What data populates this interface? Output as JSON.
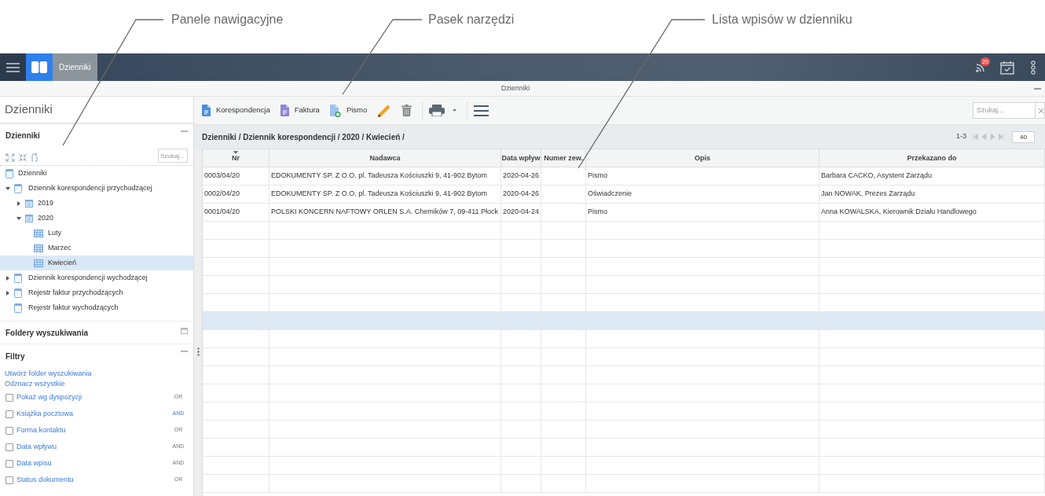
{
  "callouts": [
    {
      "label": "Panele nawigacyjne"
    },
    {
      "label": "Pasek narzędzi"
    },
    {
      "label": "Lista wpisów w dzienniku"
    }
  ],
  "app_bar": {
    "tabs": [
      {
        "label": "Dzienniki",
        "selected": true
      }
    ],
    "notifications": {
      "badge": "20"
    }
  },
  "window": {
    "title": "Dzienniki"
  },
  "sidebar": {
    "title": "Dzienniki",
    "tree_panel": {
      "title": "Dzienniki",
      "expanded": true,
      "search": {
        "placeholder": "Szukaj..."
      },
      "items": [
        {
          "label": "Dzienniki",
          "kind": "root",
          "selected": false
        },
        {
          "label": "Dziennik korespondencji przychodzącej",
          "kind": "journal",
          "expanded": true,
          "selected": false,
          "children": [
            {
              "label": "2019",
              "kind": "year",
              "expanded": false,
              "selected": false
            },
            {
              "label": "2020",
              "kind": "year",
              "expanded": true,
              "selected": false,
              "children": [
                {
                  "label": "Luty",
                  "kind": "month",
                  "selected": false
                },
                {
                  "label": "Marzec",
                  "kind": "month",
                  "selected": false
                },
                {
                  "label": "Kwiecień",
                  "kind": "month",
                  "selected": true
                }
              ]
            }
          ]
        },
        {
          "label": "Dziennik korespondencji wychodzącej",
          "kind": "journal",
          "expanded": false,
          "selected": false
        },
        {
          "label": "Rejestr faktur przychodzących",
          "kind": "journal",
          "expanded": false,
          "selected": false
        },
        {
          "label": "Rejestr faktur wychodzących",
          "kind": "journal",
          "selected": false
        }
      ]
    },
    "search_folders": {
      "title": "Foldery wyszukiwania",
      "expanded": false
    },
    "filters": {
      "title": "Filtry",
      "expanded": true,
      "links": [
        "Utwórz folder wyszukiwania",
        "Odznacz wszystkie"
      ],
      "items": [
        {
          "label": "Pokaż wg dyspozycji",
          "checked": false,
          "operator": "OR",
          "active": false
        },
        {
          "label": "Książka pocztowa",
          "checked": false,
          "operator": "AND",
          "active": true
        },
        {
          "label": "Forma kontaktu",
          "checked": false,
          "operator": "OR",
          "active": false
        },
        {
          "label": "Data wpływu",
          "checked": false,
          "operator": "AND",
          "active": false
        },
        {
          "label": "Data wpisu",
          "checked": false,
          "operator": "AND",
          "active": false
        },
        {
          "label": "Status dokumentu",
          "checked": false,
          "operator": "OR",
          "active": false
        }
      ]
    }
  },
  "toolbar": {
    "buttons": [
      {
        "kind": "correspondence",
        "label": "Korespondencja"
      },
      {
        "kind": "invoice",
        "label": "Faktura"
      },
      {
        "kind": "letter",
        "label": "Pismo"
      },
      {
        "kind": "edit"
      },
      {
        "kind": "delete"
      },
      {
        "kind": "print"
      },
      {
        "kind": "menu"
      }
    ],
    "search": {
      "placeholder": "Szukaj..."
    }
  },
  "breadcrumb": "Dzienniki / Dziennik korespondencji / 2020 / Kwiecień /",
  "pager": {
    "range": "1-3",
    "page_size": "40"
  },
  "table": {
    "columns": [
      {
        "label": "Nr",
        "sorted": true
      },
      {
        "label": "Nadawca",
        "sorted": false
      },
      {
        "label": "Data wpływ",
        "sorted": false
      },
      {
        "label": "Numer zew.",
        "sorted": false
      },
      {
        "label": "Opis",
        "sorted": false
      },
      {
        "label": "Przekazano do",
        "sorted": false
      }
    ],
    "rows": [
      {
        "nr": "0003/04/20",
        "sender": "EDOKUMENTY SP. Z O.O. pl. Tadeusza Kościuszki 9, 41-902 Bytom",
        "received": "2020-04-26",
        "description": "Pismo",
        "forwarded_to": "Barbara CACKO, Asystent Zarządu"
      },
      {
        "nr": "0002/04/20",
        "sender": "EDOKUMENTY SP. Z O.O. pl. Tadeusza Kościuszki 9, 41-902 Bytom",
        "received": "2020-04-26",
        "description": "Oświadczenie",
        "forwarded_to": "Jan NOWAK, Prezes Zarządu"
      },
      {
        "nr": "0001/04/20",
        "sender": "POLSKI KONCERN NAFTOWY ORLEN S.A. Chemików 7, 09-411 Płock",
        "received": "2020-04-24",
        "description": "Pismo",
        "forwarded_to": "Anna KOWALSKA, Kierownik Działu Handlowego"
      }
    ],
    "blank_rows": [
      {
        "selected": false
      },
      {
        "selected": false
      },
      {
        "selected": false
      },
      {
        "selected": false
      },
      {
        "selected": false
      },
      {
        "selected": true
      },
      {
        "selected": false
      },
      {
        "selected": false
      },
      {
        "selected": false
      },
      {
        "selected": false
      },
      {
        "selected": false
      },
      {
        "selected": false
      },
      {
        "selected": false
      },
      {
        "selected": false
      },
      {
        "selected": false
      }
    ]
  }
}
